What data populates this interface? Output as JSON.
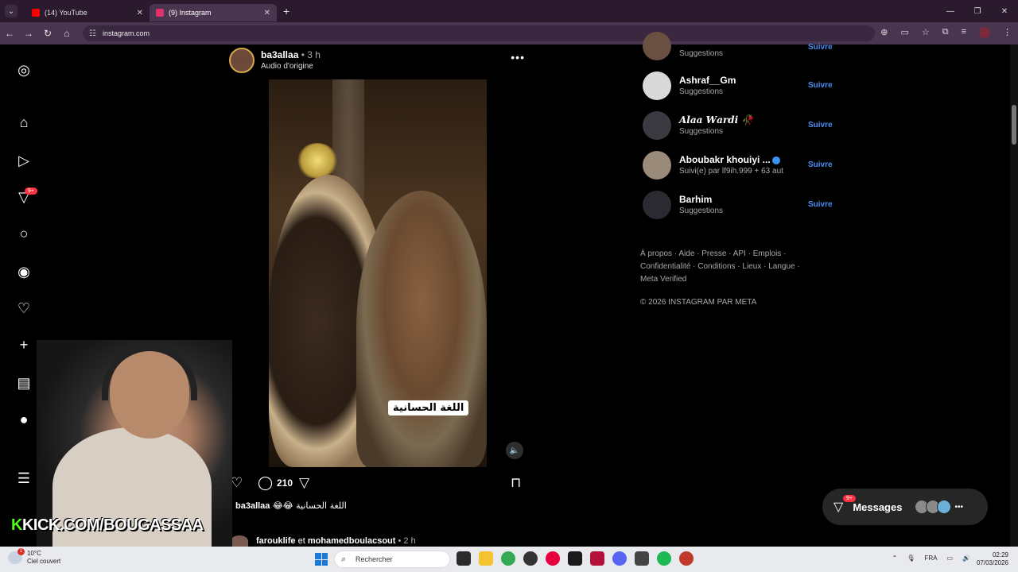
{
  "browser": {
    "tabs": [
      {
        "title": "(14) YouTube",
        "color": "#ff0000"
      },
      {
        "title": "(9) Instagram",
        "color": "#e1306c",
        "active": true
      }
    ],
    "url": "instagram.com"
  },
  "sidebar": {
    "notifications_badge": "9+"
  },
  "post": {
    "username": "ba3allaa",
    "time": " • 3 h",
    "audio": "Audio d'origine",
    "video_caption": "اللغة الحسانية",
    "comment_count": "210",
    "caption_user": "ba3allaa",
    "caption_text": " 😂😂 اللغة الحسانية",
    "next_post": {
      "user1": "farouklife",
      "conj": " et ",
      "user2": "mohamedboulacsout",
      "time": " • 2 h"
    }
  },
  "suggestions": [
    {
      "name": "",
      "sub": "Suggestions",
      "follow": "Suivre"
    },
    {
      "name": "Ashraf__Gm",
      "sub": "Suggestions",
      "follow": "Suivre"
    },
    {
      "name": "𝑨𝒍𝒂𝒂 𝑾𝒂𝒓𝒅𝒊 🥀",
      "sub": "Suggestions",
      "follow": "Suivre"
    },
    {
      "name": "Aboubakr khouiyi ...",
      "sub": "Suivi(e) par lf9ih.999 + 63 aut",
      "follow": "Suivre",
      "verified": true
    },
    {
      "name": "Barhim",
      "sub": "Suggestions",
      "follow": "Suivre"
    }
  ],
  "footer": {
    "links": "À propos · Aide · Presse · API · Emplois · Confidentialité · Conditions · Lieux · Langue · Meta Verified",
    "copyright": "© 2026 INSTAGRAM PAR META"
  },
  "messages": {
    "label": "Messages",
    "badge": "9+"
  },
  "overlay": {
    "kick_k": "K",
    "kick_text": "KICK.COM/BOUGASSAA"
  },
  "taskbar": {
    "temp": "10°C",
    "weather": "Ciel couvert",
    "weather_badge": "1",
    "search_placeholder": "Rechercher",
    "lang": "FRA",
    "time": "02:29",
    "date": "07/03/2026"
  }
}
